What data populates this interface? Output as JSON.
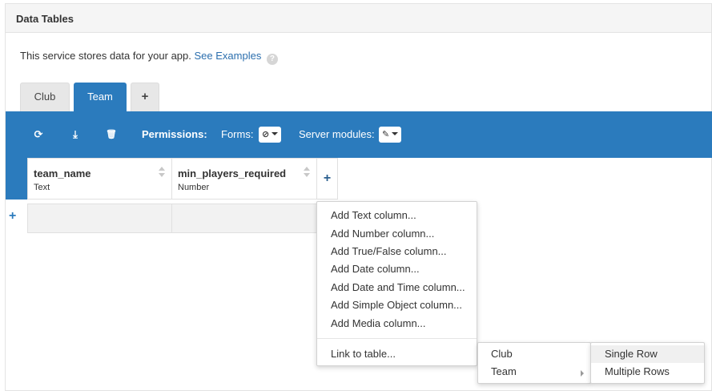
{
  "panel": {
    "title": "Data Tables"
  },
  "intro": {
    "text": "This service stores data for your app.",
    "link": "See Examples",
    "help": "?"
  },
  "tabs": [
    {
      "label": "Club",
      "active": false
    },
    {
      "label": "Team",
      "active": true
    },
    {
      "label": "+",
      "active": false
    }
  ],
  "toolbar": {
    "refresh_icon": "refresh-icon",
    "download_icon": "download-icon",
    "delete_icon": "trash-icon",
    "refresh_glyph": "⟳",
    "download_glyph": "⤓",
    "delete_glyph": "🗑",
    "permissions_label": "Permissions:",
    "forms_label": "Forms:",
    "forms_value": "⊘",
    "server_label": "Server modules:",
    "server_value": "✎"
  },
  "columns": [
    {
      "name": "team_name",
      "type": "Text"
    },
    {
      "name": "min_players_required",
      "type": "Number"
    }
  ],
  "add_column": "+",
  "add_row": "+",
  "column_menu": {
    "items": [
      "Add Text column...",
      "Add Number column...",
      "Add True/False column...",
      "Add Date column...",
      "Add Date and Time column...",
      "Add Simple Object column...",
      "Add Media column..."
    ],
    "link_item": "Link to table..."
  },
  "link_submenu": {
    "items": [
      "Club",
      "Team"
    ]
  },
  "team_submenu": {
    "items": [
      "Single Row",
      "Multiple Rows"
    ]
  },
  "colors": {
    "accent": "#2b7bbd",
    "link": "#2c6fae"
  }
}
